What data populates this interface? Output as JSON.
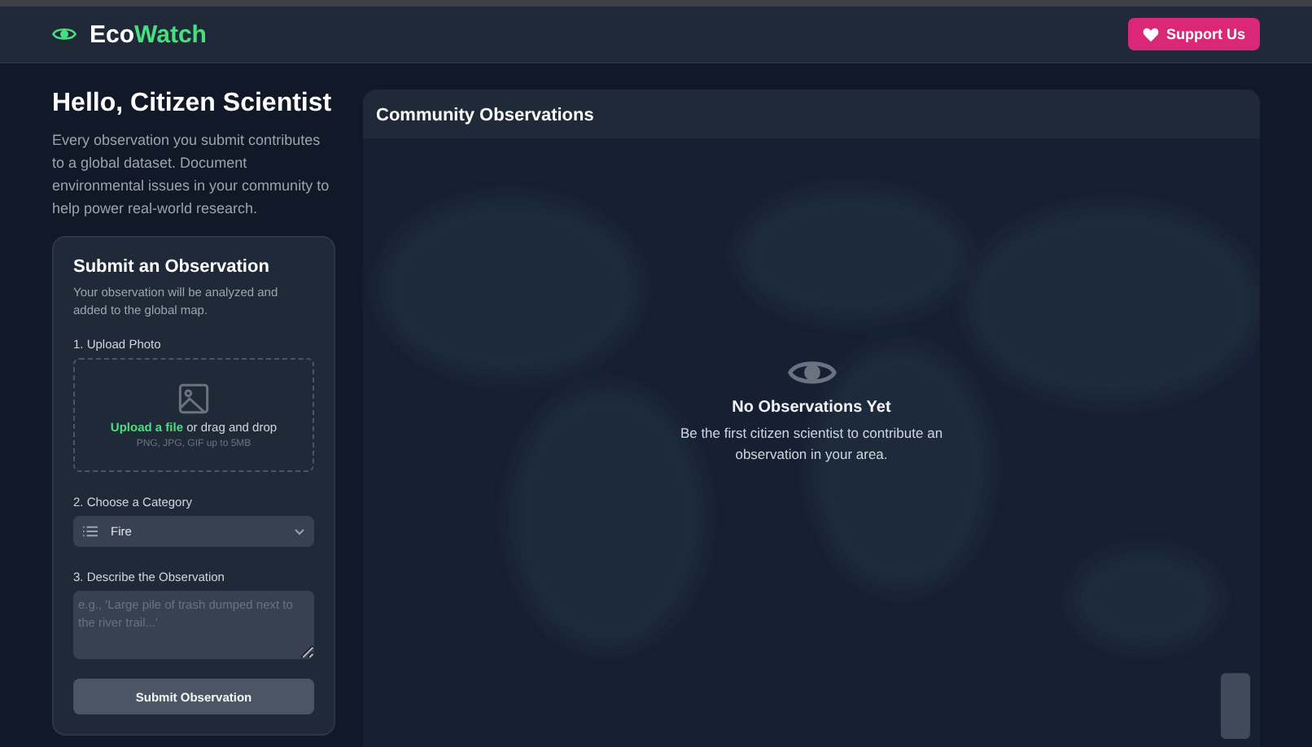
{
  "header": {
    "brand": {
      "first": "Eco",
      "second": "Watch"
    },
    "support_button": "Support Us"
  },
  "intro": {
    "title": "Hello, Citizen Scientist",
    "text": "Every observation you submit contributes to a global dataset. Document environmental issues in your community to help power real-world research."
  },
  "form": {
    "title": "Submit an Observation",
    "subtitle": "Your observation will be analyzed and added to the global map.",
    "upload": {
      "label": "1. Upload Photo",
      "link": "Upload a file",
      "text": " or drag and drop",
      "hint": "PNG, JPG, GIF up to 5MB"
    },
    "category": {
      "label": "2. Choose a Category",
      "value": "Fire"
    },
    "description": {
      "label": "3. Describe the Observation",
      "placeholder": "e.g., 'Large pile of trash dumped next to the river trail...'"
    },
    "submit": "Submit Observation"
  },
  "map": {
    "title": "Community Observations",
    "empty_title": "No Observations Yet",
    "empty_text": "Be the first citizen scientist to contribute an observation in your area."
  }
}
